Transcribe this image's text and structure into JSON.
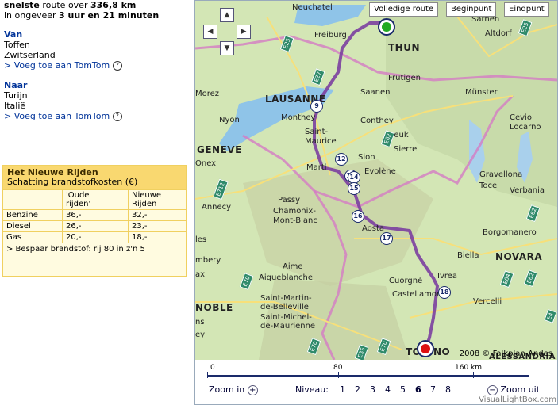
{
  "summary": {
    "line1_a": "snelste",
    "line1_b": " route over ",
    "line1_c": "336,8 km",
    "line2_a": "in ongeveer ",
    "line2_b": "3 uur en 21 minuten"
  },
  "from": {
    "heading": "Van",
    "line1": "Toffen",
    "line2": "Zwitserland",
    "add_link": "> Voeg toe aan TomTom"
  },
  "to": {
    "heading": "Naar",
    "line1": "Turijn",
    "line2": "Italië",
    "add_link": "> Voeg toe aan TomTom"
  },
  "fuel": {
    "title": "Het Nieuwe Rijden",
    "subtitle": "Schatting brandstofkosten (€)",
    "col_old_1": "'Oude",
    "col_old_2": "rijden'",
    "col_new_1": "Nieuwe",
    "col_new_2": "Rijden",
    "rows": [
      {
        "fuel": "Benzine",
        "old": "36,-",
        "new": "32,-"
      },
      {
        "fuel": "Diesel",
        "old": "26,-",
        "new": "23,-"
      },
      {
        "fuel": "Gas",
        "old": "20,-",
        "new": "18,-"
      }
    ],
    "saving_link": "> Bespaar brandstof: rij 80 in z'n 5"
  },
  "map": {
    "buttons": {
      "full_route": "Volledige route",
      "start": "Beginpunt",
      "end": "Eindpunt"
    },
    "nav_icons": [
      "up-arrow-icon",
      "left-arrow-icon",
      "right-arrow-icon",
      "down-arrow-icon"
    ],
    "labels": {
      "neuchatel": "Neuchatel",
      "freiburg": "Freiburg",
      "thun": "THUN",
      "frutigen": "Frutigen",
      "saanen": "Saanen",
      "lausanne": "LAUSANNE",
      "morez": "Morez",
      "nyon": "Nyon",
      "monthey": "Monthey",
      "saint_maurice_1": "Saint-",
      "saint_maurice_2": "Maurice",
      "conthey": "Conthey",
      "leuk": "Leuk",
      "sierre": "Sierre",
      "sion": "Sion",
      "evolene": "Evolène",
      "martigny": "Marti",
      "geneve": "GENEVE",
      "onex": "Onex",
      "annecy": "Annecy",
      "passy": "Passy",
      "chamonix": "Chamonix-",
      "mont_blanc": "Mont-Blanc",
      "aosta": "Aosta",
      "sarnen": "Sarnen",
      "altdorf": "Altdorf",
      "munster": "Münster",
      "cevio": "Cevio",
      "locarno": "Locarno",
      "gravellona": "Gravellona",
      "toce": "Toce",
      "verbania": "Verbania",
      "borgomanero": "Borgomanero",
      "biella": "Biella",
      "novara": "NOVARA",
      "ivrea": "Ivrea",
      "cuorgne": "Cuorgnè",
      "castellamonte": "Castellamonte",
      "vercelli": "Vercelli",
      "aime": "Aime",
      "aigueblanche": "Aigueblanche",
      "belleville_1": "Saint-Martin-",
      "belleville_2": "de-Belleville",
      "maurienne_1": "Saint-Michel-",
      "maurienne_2": "de-Maurienne",
      "noble": "NOBLE",
      "torino": "TO",
      "torino_2": "NO",
      "alessandria": "ALESSANDRIA",
      "les": "les",
      "mbery": "mbery",
      "ax": "ax",
      "ns": "ns",
      "ey": "ey"
    },
    "route_markers": [
      "9",
      "12",
      "13",
      "14",
      "15",
      "16",
      "17",
      "18"
    ],
    "road_shields": [
      "E25",
      "E27",
      "E62",
      "E62",
      "E25",
      "E712",
      "E70",
      "E70",
      "E70",
      "E64",
      "E62",
      "E35",
      "E4"
    ],
    "copyright": "2008 © Falkplan-Andes",
    "scale": {
      "t0": "0",
      "t80": "80",
      "t160": "160 km"
    },
    "colors": {
      "route": "#7b3fa0",
      "border": "#d070c0",
      "start": "#22aa22",
      "end": "#dd1111",
      "shield": "#2f8a6a"
    }
  },
  "zoom": {
    "zoom_in": "Zoom in",
    "zoom_out": "Zoom uit",
    "niveau_label": "Niveau:",
    "levels": [
      "1",
      "2",
      "3",
      "4",
      "5",
      "6",
      "7",
      "8"
    ],
    "active_level": "6"
  },
  "watermark": "VisualLightBox.com"
}
